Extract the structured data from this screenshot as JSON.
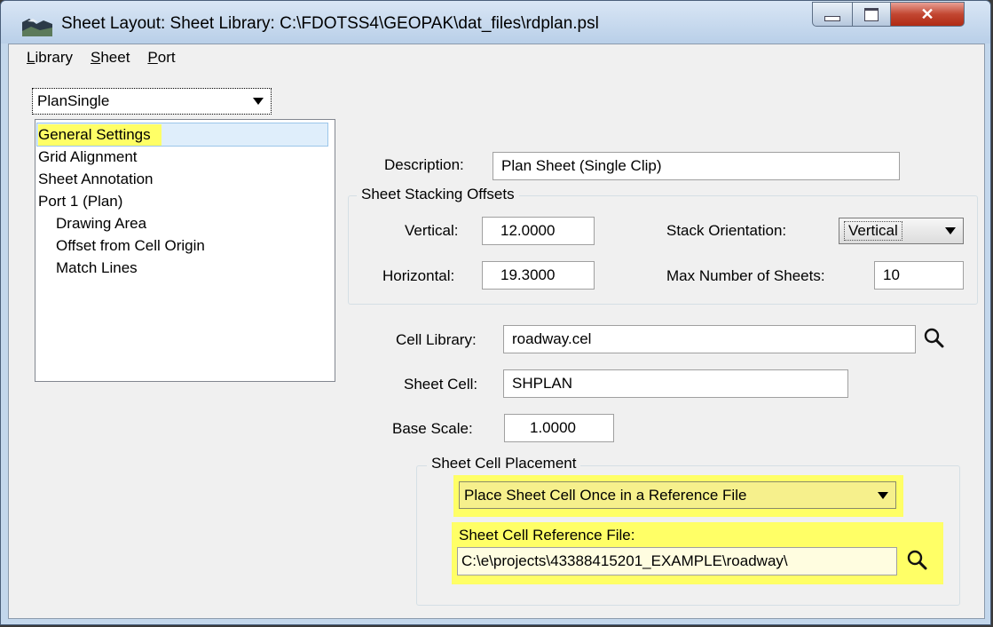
{
  "window": {
    "title": "Sheet Layout: Sheet Library: C:\\FDOTSS4\\GEOPAK\\dat_files\\rdplan.psl"
  },
  "menu": {
    "library": "Library",
    "sheet": "Sheet",
    "port": "Port"
  },
  "sheet_selector": {
    "value": "PlanSingle"
  },
  "tree": {
    "items": [
      "General Settings",
      "Grid Alignment",
      "Sheet Annotation",
      "Port 1 (Plan)",
      "Drawing Area",
      "Offset from Cell Origin",
      "Match Lines"
    ]
  },
  "form": {
    "description_label": "Description:",
    "description_value": "Plan Sheet (Single Clip)",
    "stacking_group": "Sheet Stacking Offsets",
    "vertical_label": "Vertical:",
    "vertical_value": "12.0000",
    "horizontal_label": "Horizontal:",
    "horizontal_value": "19.3000",
    "stack_orientation_label": "Stack Orientation:",
    "stack_orientation_value": "Vertical",
    "max_sheets_label": "Max Number of Sheets:",
    "max_sheets_value": "10",
    "cell_library_label": "Cell Library:",
    "cell_library_value": "roadway.cel",
    "sheet_cell_label": "Sheet Cell:",
    "sheet_cell_value": "SHPLAN",
    "base_scale_label": "Base Scale:",
    "base_scale_value": "1.0000",
    "placement_group": "Sheet Cell Placement",
    "placement_value": "Place Sheet Cell Once in a Reference File",
    "ref_file_label": "Sheet Cell Reference File:",
    "ref_file_value": "C:\\e\\projects\\43388415201_EXAMPLE\\roadway\\"
  },
  "colors": {
    "highlight": "#ffff66",
    "title_bar": "#c3d7ec",
    "close_button": "#c24631"
  },
  "icons": [
    "app-icon",
    "minimize-icon",
    "maximize-icon",
    "close-icon",
    "chevron-down-icon",
    "search-icon"
  ]
}
